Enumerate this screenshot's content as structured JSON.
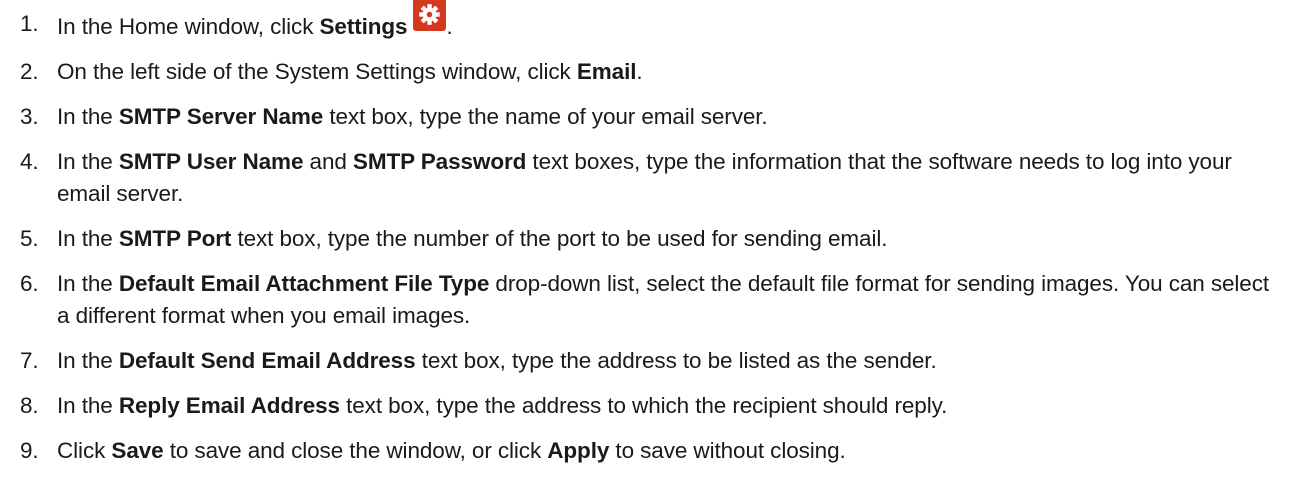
{
  "steps": [
    {
      "number": "1.",
      "parts": [
        "In the Home window, click ",
        "Settings",
        "."
      ],
      "icon": "gear-icon",
      "icon_color": "#d2391f"
    },
    {
      "number": "2.",
      "parts": [
        "On the left side of the System Settings window, click ",
        "Email",
        "."
      ]
    },
    {
      "number": "3.",
      "parts": [
        "In the ",
        "SMTP Server Name",
        " text box, type the name of your email server."
      ]
    },
    {
      "number": "4.",
      "parts": [
        "In the ",
        "SMTP User Name",
        " and ",
        "SMTP Password",
        " text boxes, type the information that the software needs to log into your email server."
      ]
    },
    {
      "number": "5.",
      "parts": [
        "In the ",
        "SMTP Port",
        " text box, type the number of the port to be used for sending email."
      ]
    },
    {
      "number": "6.",
      "parts": [
        "In the ",
        "Default Email Attachment File Type",
        " drop-down list, select the default file format for sending images. You can select a different format when you email images."
      ]
    },
    {
      "number": "7.",
      "parts": [
        "In the ",
        "Default Send Email Address",
        " text box, type the address to be listed as the sender."
      ]
    },
    {
      "number": "8.",
      "parts": [
        "In the ",
        "Reply Email Address",
        " text box, type the address to which the recipient should reply."
      ]
    },
    {
      "number": "9.",
      "parts": [
        "Click ",
        "Save",
        " to save and close the window, or click ",
        "Apply",
        " to save without closing."
      ]
    }
  ]
}
